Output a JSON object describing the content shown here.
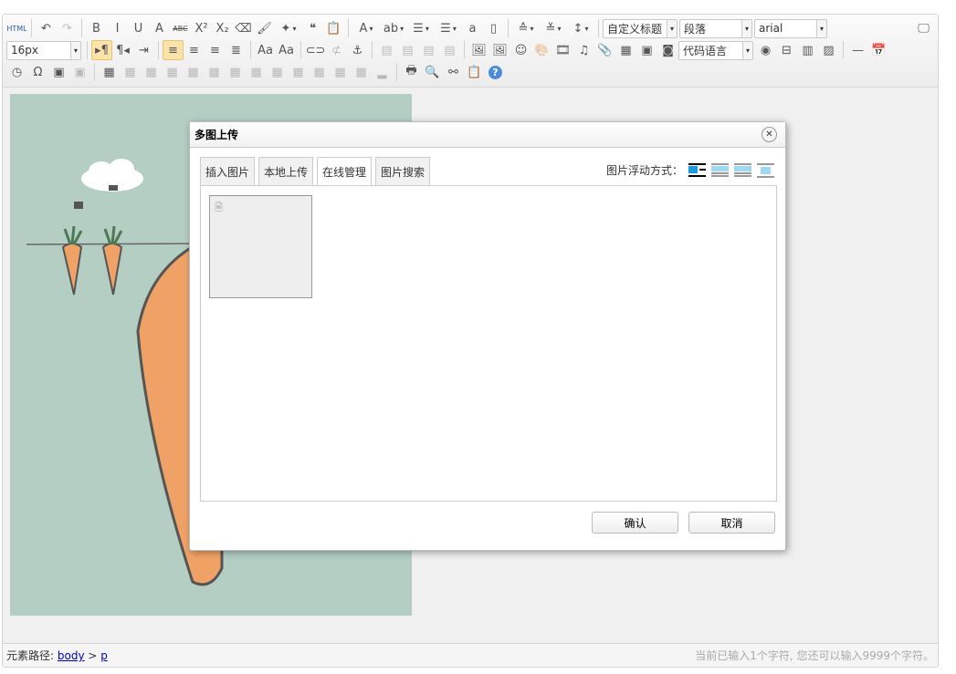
{
  "toolbar": {
    "row1": [
      {
        "icon": "html-icon",
        "g": "HTML"
      },
      {
        "sep": 1
      },
      {
        "icon": "undo-icon",
        "g": "↶"
      },
      {
        "icon": "redo-icon",
        "g": "↷",
        "dis": 1
      },
      {
        "sep": 1
      },
      {
        "icon": "bold-icon",
        "g": "B"
      },
      {
        "icon": "italic-icon",
        "g": "I"
      },
      {
        "icon": "underline-icon",
        "g": "U"
      },
      {
        "icon": "fontborder-icon",
        "g": "A"
      },
      {
        "icon": "strikethrough-icon",
        "g": "ABC"
      },
      {
        "icon": "superscript-icon",
        "g": "X²"
      },
      {
        "icon": "subscript-icon",
        "g": "X₂"
      },
      {
        "icon": "eraser-icon",
        "g": "⌫"
      },
      {
        "icon": "format-painter-icon",
        "g": "🖌"
      },
      {
        "icon": "autotypeset-icon",
        "g": "✦",
        "dd": 1
      },
      {
        "icon": "blockquote-icon",
        "g": "❝"
      },
      {
        "icon": "paste-plain-icon",
        "g": "📋"
      },
      {
        "sep": 1
      },
      {
        "icon": "forecolor-icon",
        "g": "A",
        "dd": 1
      },
      {
        "icon": "backcolor-icon",
        "g": "ab",
        "dd": 1
      },
      {
        "icon": "ordered-list-icon",
        "g": "☰",
        "dd": 1
      },
      {
        "icon": "unordered-list-icon",
        "g": "☰",
        "dd": 1
      },
      {
        "icon": "select-all-icon",
        "g": "a"
      },
      {
        "icon": "clear-doc-icon",
        "g": "▯"
      },
      {
        "sep": 1
      },
      {
        "icon": "rowspacing-top-icon",
        "g": "≙",
        "dd": 1
      },
      {
        "icon": "rowspacing-bottom-icon",
        "g": "≚",
        "dd": 1
      },
      {
        "icon": "lineheight-icon",
        "g": "↕",
        "dd": 1
      },
      {
        "sep": 1
      }
    ],
    "custom_style": "自定义标题",
    "paragraph": "段落",
    "font_family": "arial",
    "font_size": "16px",
    "row2": [
      {
        "sep": 1
      },
      {
        "icon": "ltr-icon",
        "g": "▸¶",
        "active": 1
      },
      {
        "icon": "rtl-icon",
        "g": "¶◂"
      },
      {
        "icon": "indent-icon",
        "g": "⇥"
      },
      {
        "sep": 1
      },
      {
        "icon": "align-left-icon",
        "g": "≡",
        "active": 1
      },
      {
        "icon": "align-center-icon",
        "g": "≡"
      },
      {
        "icon": "align-right-icon",
        "g": "≡"
      },
      {
        "icon": "justify-icon",
        "g": "≣"
      },
      {
        "sep": 1
      },
      {
        "icon": "touppercase-icon",
        "g": "Aa"
      },
      {
        "icon": "tolowercase-icon",
        "g": "Aa"
      },
      {
        "sep": 1
      },
      {
        "icon": "link-icon",
        "g": "⊂⊃"
      },
      {
        "icon": "unlink-icon",
        "g": "⊄",
        "dis": 1
      },
      {
        "icon": "anchor-icon",
        "g": "⚓"
      },
      {
        "sep": 1
      },
      {
        "icon": "image-none-icon",
        "g": "▤",
        "dis": 1
      },
      {
        "icon": "image-left-icon",
        "g": "▤",
        "dis": 1
      },
      {
        "icon": "image-right-icon",
        "g": "▤",
        "dis": 1
      },
      {
        "icon": "image-center-icon",
        "g": "▤",
        "dis": 1
      },
      {
        "sep": 1
      },
      {
        "icon": "simple-upload-icon",
        "g": "🖼"
      },
      {
        "icon": "insert-image-icon",
        "g": "🖼"
      },
      {
        "icon": "emotion-icon",
        "g": "☺"
      },
      {
        "icon": "scrawl-icon",
        "g": "🎨",
        "dis": 1
      },
      {
        "icon": "insert-video-icon",
        "g": "🎞"
      },
      {
        "icon": "music-icon",
        "g": "♫"
      },
      {
        "icon": "attachment-icon",
        "g": "📎"
      },
      {
        "icon": "map-icon",
        "g": "▦"
      },
      {
        "icon": "gmap-icon",
        "g": "▣"
      },
      {
        "icon": "insertframe-icon",
        "g": "◙"
      }
    ],
    "code_language": "代码语言",
    "row2b": [
      {
        "icon": "webapp-icon",
        "g": "◉"
      },
      {
        "icon": "pagebreak-icon",
        "g": "⊟"
      },
      {
        "icon": "template-icon",
        "g": "▥"
      },
      {
        "icon": "background-icon",
        "g": "▨"
      },
      {
        "sep": 1
      },
      {
        "icon": "horizontal-icon",
        "g": "—"
      },
      {
        "icon": "date-icon",
        "g": "📅"
      }
    ],
    "row3": [
      {
        "icon": "time-icon",
        "g": "◷"
      },
      {
        "icon": "special-chars-icon",
        "g": "Ω"
      },
      {
        "icon": "snapscreen-icon",
        "g": "▣"
      },
      {
        "icon": "wordimage-icon",
        "g": "▣",
        "dis": 1
      },
      {
        "sep": 1
      },
      {
        "icon": "insert-table-icon",
        "g": "▦"
      },
      {
        "icon": "delete-table-icon",
        "g": "▦",
        "dis": 1
      },
      {
        "icon": "insert-caption-icon",
        "g": "▦",
        "dis": 1
      },
      {
        "icon": "insert-row-icon",
        "g": "▦",
        "dis": 1
      },
      {
        "icon": "delete-row-icon",
        "g": "▦",
        "dis": 1
      },
      {
        "icon": "insert-col-icon",
        "g": "▦",
        "dis": 1
      },
      {
        "icon": "delete-col-icon",
        "g": "▦",
        "dis": 1
      },
      {
        "icon": "merge-cells-icon",
        "g": "▦",
        "dis": 1
      },
      {
        "icon": "merge-right-icon",
        "g": "▦",
        "dis": 1
      },
      {
        "icon": "merge-down-icon",
        "g": "▦",
        "dis": 1
      },
      {
        "icon": "split-cells-icon",
        "g": "▦",
        "dis": 1
      },
      {
        "icon": "split-rows-icon",
        "g": "▦",
        "dis": 1
      },
      {
        "icon": "split-cols-icon",
        "g": "▦",
        "dis": 1
      },
      {
        "icon": "charts-icon",
        "g": "▂",
        "dis": 1
      },
      {
        "sep": 1
      },
      {
        "icon": "print-icon",
        "g": "🖶"
      },
      {
        "icon": "preview-icon",
        "g": "🔍"
      },
      {
        "icon": "search-replace-icon",
        "g": "⚯"
      },
      {
        "icon": "drafts-icon",
        "g": "📋"
      },
      {
        "icon": "help-icon",
        "g": "?"
      }
    ],
    "fullscreen_icon": "fullscreen-icon"
  },
  "dialog": {
    "title": "多图上传",
    "tabs": [
      "插入图片",
      "本地上传",
      "在线管理",
      "图片搜索"
    ],
    "active_tab": 2,
    "float_label": "图片浮动方式：",
    "confirm": "确认",
    "cancel": "取消"
  },
  "statusbar": {
    "path_label": "元素路径:",
    "path_body": "body",
    "path_sep": " > ",
    "path_p": "p",
    "word_count": "当前已输入1个字符, 您还可以输入9999个字符。"
  }
}
